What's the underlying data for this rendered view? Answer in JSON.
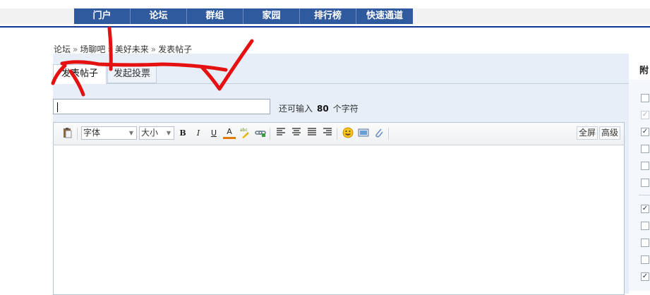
{
  "nav": {
    "items": [
      "门户",
      "论坛",
      "群组",
      "家园",
      "排行榜",
      "快速通道"
    ]
  },
  "breadcrumb": {
    "items": [
      "论坛",
      "场聊吧",
      "美好未来",
      "发表帖子"
    ],
    "separator": "»"
  },
  "tabs": [
    {
      "label": "发表帖子",
      "active": true
    },
    {
      "label": "发起投票",
      "active": false
    }
  ],
  "subject": {
    "value": "",
    "remaining_prefix": "还可输入",
    "remaining_count": "80",
    "remaining_suffix": "个字符"
  },
  "editor": {
    "font_select": "字体",
    "size_select": "大小",
    "bold": "B",
    "italic": "I",
    "underline": "U",
    "color": "A",
    "fullscreen": "全屏",
    "advanced": "高级"
  },
  "side": {
    "label": "附",
    "checkboxes": [
      false,
      true,
      true,
      false,
      false,
      false,
      true,
      false,
      false,
      false,
      true
    ],
    "disabled": [
      false,
      true,
      false,
      false,
      false,
      false,
      false,
      false,
      false,
      false,
      false
    ]
  },
  "colors": {
    "nav_bg": "#2f5a9e",
    "top_line": "#11369a",
    "panel_bg": "#e7eef7",
    "annotation": "#e51010"
  }
}
